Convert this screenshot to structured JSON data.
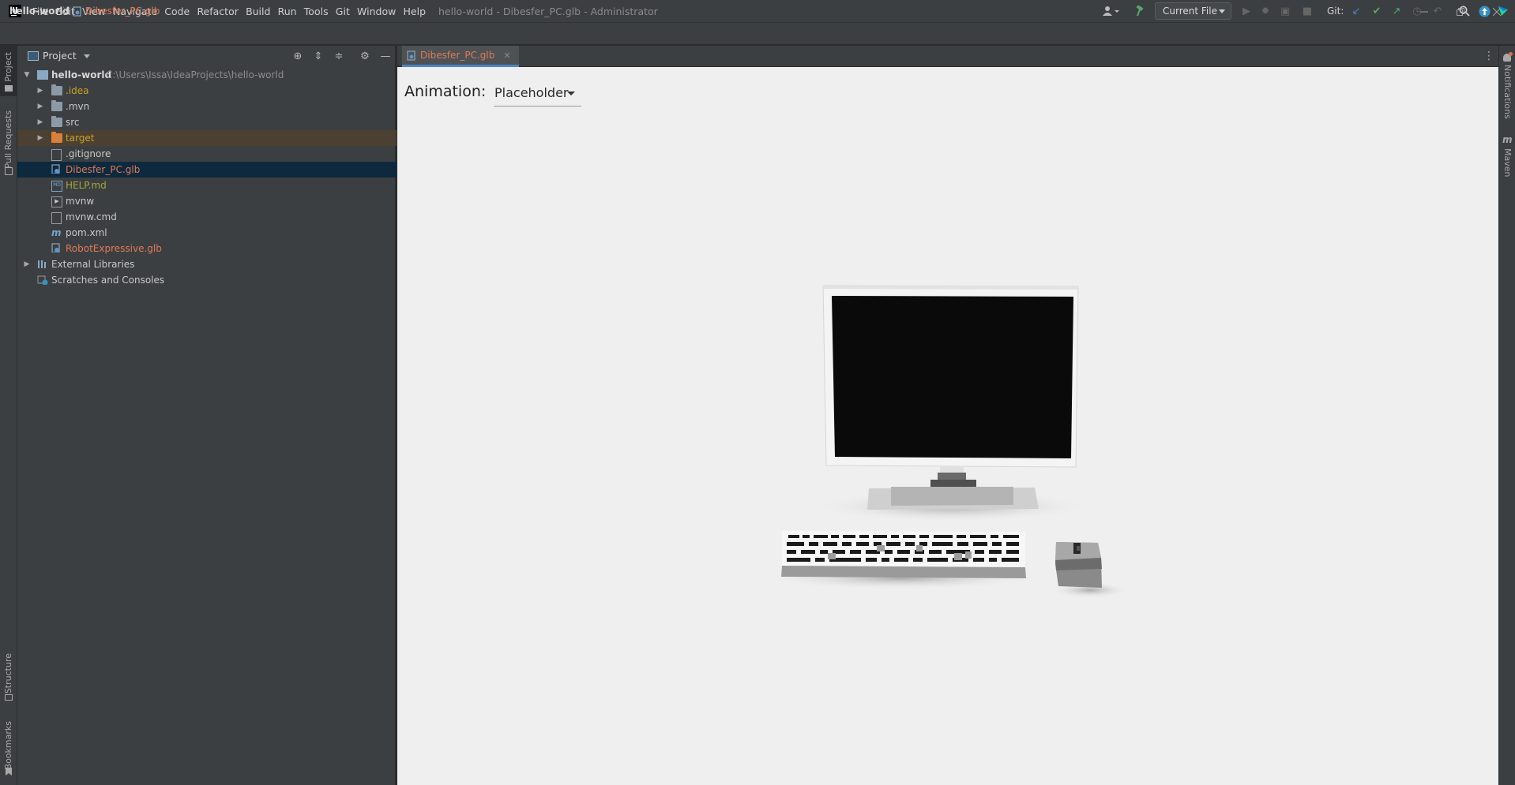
{
  "window": {
    "title": "hello-world - Dibesfer_PC.glb - Administrator",
    "menu": [
      "File",
      "Edit",
      "View",
      "Navigate",
      "Code",
      "Refactor",
      "Build",
      "Run",
      "Tools",
      "Git",
      "Window",
      "Help"
    ]
  },
  "navbar": {
    "project": "hello-world",
    "file": "Dibesfer_PC.glb",
    "run_config": "Current File",
    "git_label": "Git:"
  },
  "left_stripe": {
    "project": "Project",
    "pull_requests": "Pull Requests",
    "structure": "Structure",
    "bookmarks": "Bookmarks"
  },
  "right_stripe": {
    "notifications": "Notifications",
    "maven": "Maven"
  },
  "project_panel": {
    "title": "Project",
    "root": {
      "name": "hello-world",
      "path": "C:\\Users\\Issa\\IdeaProjects\\hello-world"
    },
    "items": [
      {
        "label": ".idea",
        "kind": "folder",
        "color": "#c9a227",
        "expandable": true
      },
      {
        "label": ".mvn",
        "kind": "folder",
        "color": "#c7c7c7",
        "expandable": true
      },
      {
        "label": "src",
        "kind": "folder",
        "color": "#c7c7c7",
        "expandable": true
      },
      {
        "label": "target",
        "kind": "folder-excluded",
        "color": "#c9a227",
        "expandable": true
      },
      {
        "label": ".gitignore",
        "kind": "file",
        "color": "#c7c7c7"
      },
      {
        "label": "Dibesfer_PC.glb",
        "kind": "file-3d",
        "color": "#e0795a"
      },
      {
        "label": "HELP.md",
        "kind": "file-md",
        "color": "#a6a63a"
      },
      {
        "label": "mvnw",
        "kind": "file-exec",
        "color": "#c7c7c7"
      },
      {
        "label": "mvnw.cmd",
        "kind": "file",
        "color": "#c7c7c7"
      },
      {
        "label": "pom.xml",
        "kind": "file-maven",
        "color": "#c7c7c7"
      },
      {
        "label": "RobotExpressive.glb",
        "kind": "file-3d",
        "color": "#e0795a"
      }
    ],
    "external_libraries": "External Libraries",
    "scratches": "Scratches and Consoles"
  },
  "editor": {
    "tab": "Dibesfer_PC.glb",
    "animation_label": "Animation:",
    "animation_value": "Placeholder"
  }
}
